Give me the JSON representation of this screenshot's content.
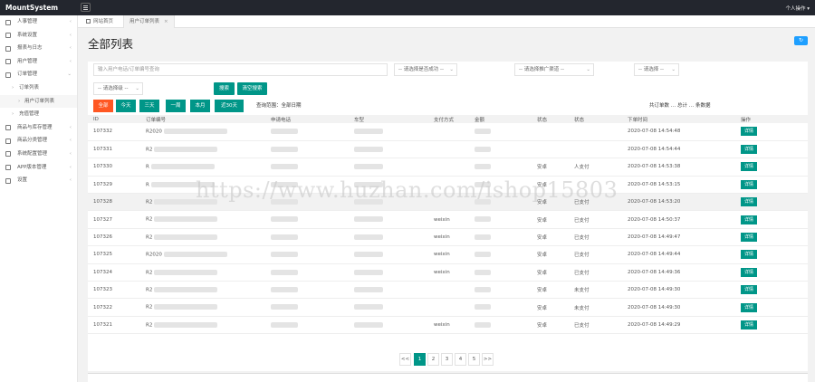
{
  "app": {
    "title": "MountSystem",
    "user_menu": "个人操作 ▾"
  },
  "sidebar": {
    "items": [
      {
        "label": "人事管理",
        "arrow": "‹"
      },
      {
        "label": "系统设置",
        "arrow": "‹"
      },
      {
        "label": "报表与日志",
        "arrow": "‹"
      },
      {
        "label": "用户管理",
        "arrow": "‹"
      },
      {
        "label": "订单管理",
        "arrow": "⌄"
      },
      {
        "label": "订单列表",
        "dot": "›"
      },
      {
        "label": "用户订单列表",
        "dot": "›"
      },
      {
        "label": "充值管理",
        "dot": "›"
      },
      {
        "label": "商品与库存管理",
        "arrow": "‹"
      },
      {
        "label": "商品分类管理",
        "arrow": "‹"
      },
      {
        "label": "系统配置管理",
        "arrow": "‹"
      },
      {
        "label": "APP版本管理",
        "arrow": "‹"
      },
      {
        "label": "设置",
        "arrow": "‹"
      }
    ]
  },
  "tabs": {
    "home": "网站首页",
    "active": "用户订单列表",
    "close": "×"
  },
  "page": {
    "title": "全部列表",
    "refresh": "↻"
  },
  "filters": {
    "search_placeholder": "输入用户电话/订单编号查询",
    "status_select": "-- 请选择是否成功 --",
    "rating_select": "-- 请选择推广渠道 --",
    "channel_select": "-- 请选择 --",
    "level_select": "-- 请选择级 --",
    "caret": "⌄",
    "search_btn": "搜索",
    "clear_btn": "清空搜索"
  },
  "range_buttons": [
    "全部",
    "今天",
    "三天",
    "一周",
    "本月",
    "近30天"
  ],
  "range_label": "查询范围：全部日期",
  "totals": "共订单数 … 总计 … 条数据",
  "table": {
    "headers": [
      "ID",
      "订单编号",
      "申请电话",
      "车型",
      "支付方式",
      "金额",
      "状态",
      "状态",
      "下单时间",
      "操作"
    ],
    "rows": [
      {
        "id": "107332",
        "order": "R2020",
        "pay": "",
        "status": "",
        "status2": "",
        "time": "2020-07-08 14:54:48",
        "btn": "详情"
      },
      {
        "id": "107331",
        "order": "R2",
        "pay": "",
        "status": "",
        "status2": "",
        "time": "2020-07-08 14:54:44",
        "btn": "详情"
      },
      {
        "id": "107330",
        "order": "R",
        "pay": "",
        "status": "安卓",
        "status2": "人支付",
        "time": "2020-07-08 14:53:38",
        "btn": "详情"
      },
      {
        "id": "107329",
        "order": "R",
        "pay": "",
        "status": "安卓",
        "status2": "",
        "time": "2020-07-08 14:53:15",
        "btn": "详情"
      },
      {
        "id": "107328",
        "order": "R2",
        "pay": "",
        "status": "安卓",
        "status2": "已支付",
        "time": "2020-07-08 14:53:20",
        "btn": "详情"
      },
      {
        "id": "107327",
        "order": "R2",
        "pay": "weixin",
        "status": "安卓",
        "status2": "已支付",
        "time": "2020-07-08 14:50:37",
        "btn": "详情"
      },
      {
        "id": "107326",
        "order": "R2",
        "pay": "weixin",
        "status": "安卓",
        "status2": "已支付",
        "time": "2020-07-08 14:49:47",
        "btn": "详情"
      },
      {
        "id": "107325",
        "order": "R2020",
        "pay": "weixin",
        "status": "安卓",
        "status2": "已支付",
        "time": "2020-07-08 14:49:44",
        "btn": "详情"
      },
      {
        "id": "107324",
        "order": "R2",
        "pay": "weixin",
        "status": "安卓",
        "status2": "已支付",
        "time": "2020-07-08 14:49:36",
        "btn": "详情"
      },
      {
        "id": "107323",
        "order": "R2",
        "pay": "",
        "status": "安卓",
        "status2": "未支付",
        "time": "2020-07-08 14:49:30",
        "btn": "详情"
      },
      {
        "id": "107322",
        "order": "R2",
        "pay": "",
        "status": "安卓",
        "status2": "未支付",
        "time": "2020-07-08 14:49:30",
        "btn": "详情"
      },
      {
        "id": "107321",
        "order": "R2",
        "pay": "weixin",
        "status": "安卓",
        "status2": "已支付",
        "time": "2020-07-08 14:49:29",
        "btn": "详情"
      }
    ]
  },
  "pagination": {
    "prev": "<<",
    "pages": [
      "1",
      "2",
      "3",
      "4",
      "5"
    ],
    "next": ">>",
    "current": "1"
  },
  "watermark": "https://www.huzhan.com/ishop15803",
  "colors": {
    "primary": "#009688",
    "active_filter": "#ff5722",
    "topbar": "#23262e",
    "refresh": "#1e9fff"
  }
}
